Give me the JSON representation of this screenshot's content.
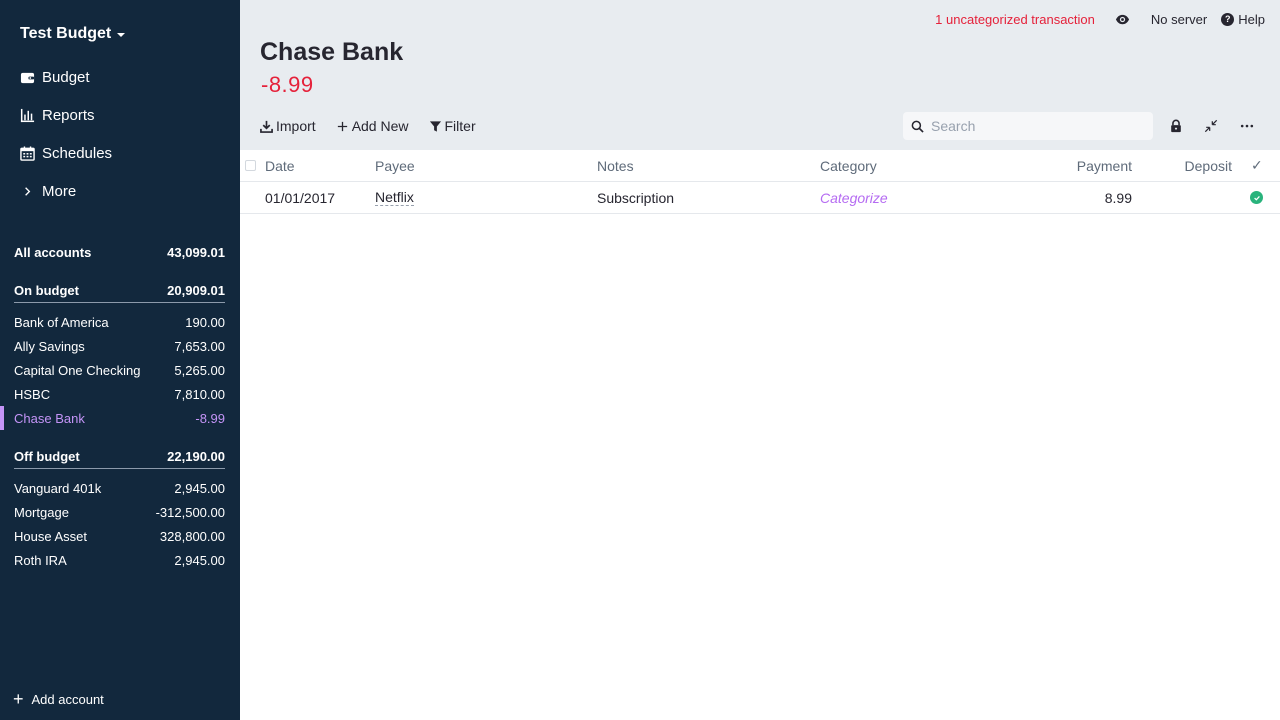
{
  "sidebar": {
    "budget_name": "Test Budget",
    "nav": [
      {
        "label": "Budget",
        "icon": "wallet-icon"
      },
      {
        "label": "Reports",
        "icon": "bar-chart-icon"
      },
      {
        "label": "Schedules",
        "icon": "calendar-icon"
      },
      {
        "label": "More",
        "icon": "chevron-right-icon"
      }
    ],
    "all_accounts": {
      "label": "All accounts",
      "balance": "43,099.01"
    },
    "on_budget": {
      "label": "On budget",
      "balance": "20,909.01"
    },
    "on_budget_accounts": [
      {
        "label": "Bank of America",
        "balance": "190.00"
      },
      {
        "label": "Ally Savings",
        "balance": "7,653.00"
      },
      {
        "label": "Capital One Checking",
        "balance": "5,265.00"
      },
      {
        "label": "HSBC",
        "balance": "7,810.00"
      },
      {
        "label": "Chase Bank",
        "balance": "-8.99"
      }
    ],
    "off_budget": {
      "label": "Off budget",
      "balance": "22,190.00"
    },
    "off_budget_accounts": [
      {
        "label": "Vanguard 401k",
        "balance": "2,945.00"
      },
      {
        "label": "Mortgage",
        "balance": "-312,500.00"
      },
      {
        "label": "House Asset",
        "balance": "328,800.00"
      },
      {
        "label": "Roth IRA",
        "balance": "2,945.00"
      }
    ],
    "add_account": "Add account"
  },
  "topbar": {
    "uncategorized": "1 uncategorized transaction",
    "server": "No server",
    "help": "Help"
  },
  "account": {
    "title": "Chase Bank",
    "balance": "-8.99"
  },
  "toolbar": {
    "import": "Import",
    "add_new": "Add New",
    "filter": "Filter",
    "search_placeholder": "Search"
  },
  "table": {
    "headers": {
      "date": "Date",
      "payee": "Payee",
      "notes": "Notes",
      "category": "Category",
      "payment": "Payment",
      "deposit": "Deposit",
      "cleared": "✓"
    },
    "rows": [
      {
        "date": "01/01/2017",
        "payee": "Netflix",
        "notes": "Subscription",
        "category": "Categorize",
        "payment": "8.99",
        "deposit": ""
      }
    ]
  },
  "colors": {
    "sidebar_bg": "#12283d",
    "accent": "#c494f7",
    "negative": "#e5213a",
    "cleared": "#29b37c"
  }
}
